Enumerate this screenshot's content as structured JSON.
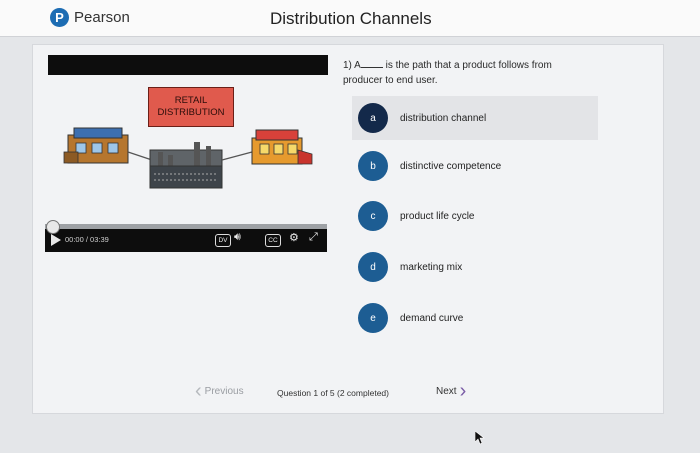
{
  "header": {
    "logo_letter": "P",
    "brand": "Pearson",
    "title": "Distribution Channels"
  },
  "video": {
    "sign_text": "RETAIL DISTRIBUTION",
    "time": "00:00 / 03:39",
    "dv_label": "DV",
    "cc_label": "CC",
    "progress": 0
  },
  "question": {
    "number": "1)",
    "lead": "A",
    "text": "is the path that a product follows from producer to end user."
  },
  "options": [
    {
      "letter": "a",
      "text": "distribution channel",
      "selected": true
    },
    {
      "letter": "b",
      "text": "distinctive competence",
      "selected": false
    },
    {
      "letter": "c",
      "text": "product life cycle",
      "selected": false
    },
    {
      "letter": "d",
      "text": "marketing mix",
      "selected": false
    },
    {
      "letter": "e",
      "text": "demand curve",
      "selected": false
    }
  ],
  "footer": {
    "previous": "Previous",
    "status": "Question 1 of 5 (2 completed)",
    "next": "Next"
  }
}
